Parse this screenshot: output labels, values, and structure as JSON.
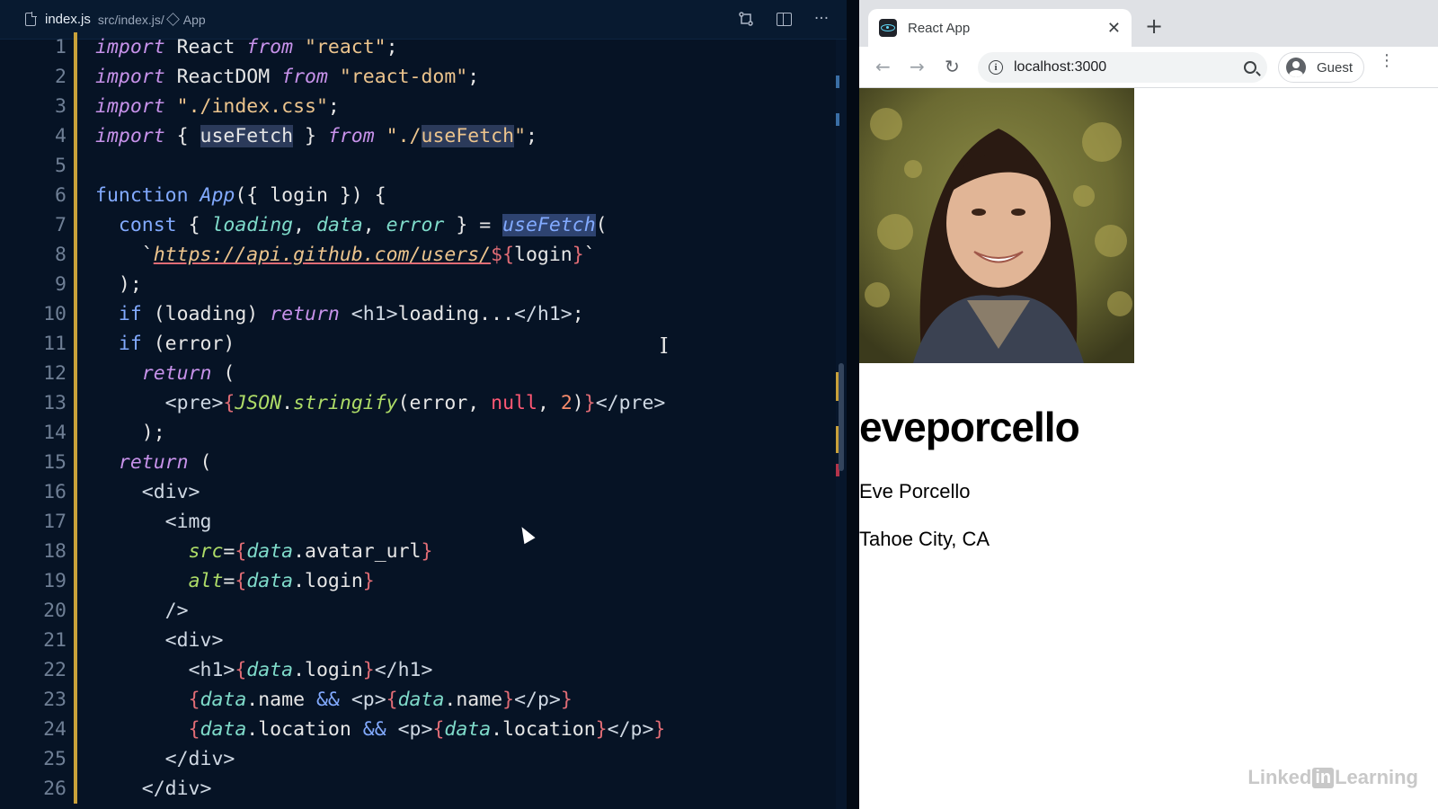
{
  "editor": {
    "filename": "index.js",
    "breadcrumb_path": "src/index.js/",
    "breadcrumb_symbol": "App",
    "line_numbers": [
      "1",
      "2",
      "3",
      "4",
      "5",
      "6",
      "7",
      "8",
      "9",
      "10",
      "11",
      "12",
      "13",
      "14",
      "15",
      "16",
      "17",
      "18",
      "19",
      "20",
      "21",
      "22",
      "23",
      "24",
      "25",
      "26"
    ],
    "lines": [
      [
        [
          "kw",
          "import"
        ],
        [
          "punc",
          " React "
        ],
        [
          "kw",
          "from"
        ],
        [
          "punc",
          " "
        ],
        [
          "str",
          "\"react\""
        ],
        [
          "punc",
          ";"
        ]
      ],
      [
        [
          "kw",
          "import"
        ],
        [
          "punc",
          " ReactDOM "
        ],
        [
          "kw",
          "from"
        ],
        [
          "punc",
          " "
        ],
        [
          "str",
          "\"react-dom\""
        ],
        [
          "punc",
          ";"
        ]
      ],
      [
        [
          "kw",
          "import"
        ],
        [
          "punc",
          " "
        ],
        [
          "str",
          "\"./index.css\""
        ],
        [
          "punc",
          ";"
        ]
      ],
      [
        [
          "kw",
          "import"
        ],
        [
          "punc",
          " { "
        ],
        [
          "hl",
          "useFetch"
        ],
        [
          "punc",
          " } "
        ],
        [
          "kw",
          "from"
        ],
        [
          "punc",
          " "
        ],
        [
          "str",
          "\"./"
        ],
        [
          "hlstr",
          "useFetch"
        ],
        [
          "str",
          "\""
        ],
        [
          "punc",
          ";"
        ]
      ],
      [],
      [
        [
          "kp",
          "function"
        ],
        [
          "punc",
          " "
        ],
        [
          "fn",
          "App"
        ],
        [
          "punc",
          "({ login }) {"
        ]
      ],
      [
        [
          "punc",
          "  "
        ],
        [
          "kp",
          "const"
        ],
        [
          "punc",
          " { "
        ],
        [
          "var",
          "loading"
        ],
        [
          "punc",
          ", "
        ],
        [
          "var",
          "data"
        ],
        [
          "punc",
          ", "
        ],
        [
          "var",
          "error"
        ],
        [
          "punc",
          " } = "
        ],
        [
          "hlfn",
          "useFetch"
        ],
        [
          "punc",
          "("
        ]
      ],
      [
        [
          "punc",
          "    `"
        ],
        [
          "url",
          "https://api.github.com/users/"
        ],
        [
          "br",
          "${"
        ],
        [
          "punc",
          "login"
        ],
        [
          "br",
          "}"
        ],
        [
          "punc",
          "`"
        ]
      ],
      [
        [
          "punc",
          "  );"
        ]
      ],
      [
        [
          "punc",
          "  "
        ],
        [
          "kp",
          "if"
        ],
        [
          "punc",
          " (loading) "
        ],
        [
          "kw",
          "return"
        ],
        [
          "punc",
          " "
        ],
        [
          "tag",
          "<h1>"
        ],
        [
          "punc",
          "loading..."
        ],
        [
          "tag",
          "</h1>"
        ],
        [
          "punc",
          ";"
        ]
      ],
      [
        [
          "punc",
          "  "
        ],
        [
          "kp",
          "if"
        ],
        [
          "punc",
          " (error)"
        ]
      ],
      [
        [
          "punc",
          "    "
        ],
        [
          "kw",
          "return"
        ],
        [
          "punc",
          " ("
        ]
      ],
      [
        [
          "punc",
          "      "
        ],
        [
          "tag",
          "<pre>"
        ],
        [
          "br",
          "{"
        ],
        [
          "attr",
          "JSON"
        ],
        [
          "punc",
          "."
        ],
        [
          "attr",
          "stringify"
        ],
        [
          "punc",
          "(error, "
        ],
        [
          "lit",
          "null"
        ],
        [
          "punc",
          ", "
        ],
        [
          "num",
          "2"
        ],
        [
          "punc",
          ")"
        ],
        [
          "br",
          "}"
        ],
        [
          "tag",
          "</pre>"
        ]
      ],
      [
        [
          "punc",
          "    );"
        ]
      ],
      [
        [
          "punc",
          "  "
        ],
        [
          "kw",
          "return"
        ],
        [
          "punc",
          " ("
        ]
      ],
      [
        [
          "punc",
          "    "
        ],
        [
          "tag",
          "<div>"
        ]
      ],
      [
        [
          "punc",
          "      "
        ],
        [
          "tag",
          "<img"
        ]
      ],
      [
        [
          "punc",
          "        "
        ],
        [
          "attr",
          "src"
        ],
        [
          "punc",
          "="
        ],
        [
          "br",
          "{"
        ],
        [
          "var",
          "data"
        ],
        [
          "punc",
          ".avatar_url"
        ],
        [
          "br",
          "}"
        ]
      ],
      [
        [
          "punc",
          "        "
        ],
        [
          "attr",
          "alt"
        ],
        [
          "punc",
          "="
        ],
        [
          "br",
          "{"
        ],
        [
          "var",
          "data"
        ],
        [
          "punc",
          ".login"
        ],
        [
          "br",
          "}"
        ]
      ],
      [
        [
          "punc",
          "      "
        ],
        [
          "tag",
          "/>"
        ]
      ],
      [
        [
          "punc",
          "      "
        ],
        [
          "tag",
          "<div>"
        ]
      ],
      [
        [
          "punc",
          "        "
        ],
        [
          "tag",
          "<h1>"
        ],
        [
          "br",
          "{"
        ],
        [
          "var",
          "data"
        ],
        [
          "punc",
          ".login"
        ],
        [
          "br",
          "}"
        ],
        [
          "tag",
          "</h1>"
        ]
      ],
      [
        [
          "punc",
          "        "
        ],
        [
          "br",
          "{"
        ],
        [
          "var",
          "data"
        ],
        [
          "punc",
          ".name "
        ],
        [
          "kp",
          "&&"
        ],
        [
          "punc",
          " "
        ],
        [
          "tag",
          "<p>"
        ],
        [
          "br",
          "{"
        ],
        [
          "var",
          "data"
        ],
        [
          "punc",
          ".name"
        ],
        [
          "br",
          "}"
        ],
        [
          "tag",
          "</p>"
        ],
        [
          "br",
          "}"
        ]
      ],
      [
        [
          "punc",
          "        "
        ],
        [
          "br",
          "{"
        ],
        [
          "var",
          "data"
        ],
        [
          "punc",
          ".location "
        ],
        [
          "kp",
          "&&"
        ],
        [
          "punc",
          " "
        ],
        [
          "tag",
          "<p>"
        ],
        [
          "br",
          "{"
        ],
        [
          "var",
          "data"
        ],
        [
          "punc",
          ".location"
        ],
        [
          "br",
          "}"
        ],
        [
          "tag",
          "</p>"
        ],
        [
          "br",
          "}"
        ]
      ],
      [
        [
          "punc",
          "      "
        ],
        [
          "tag",
          "</div>"
        ]
      ],
      [
        [
          "punc",
          "    "
        ],
        [
          "tag",
          "</div>"
        ]
      ]
    ],
    "modified_lines": [
      1,
      2,
      3,
      4,
      5,
      6,
      7,
      8,
      9,
      10,
      11,
      12,
      13,
      14,
      15,
      16,
      17,
      18,
      19,
      20,
      21,
      22,
      23,
      24,
      25,
      26
    ]
  },
  "browser": {
    "tab_title": "React App",
    "url": "localhost:3000",
    "profile_label": "Guest"
  },
  "profile_page": {
    "login": "eveporcello",
    "name": "Eve Porcello",
    "location": "Tahoe City, CA",
    "avatar_alt": "eveporcello"
  },
  "watermark": {
    "left": "Linked",
    "mid": "in",
    "right": "Learning"
  },
  "colors": {
    "editor_bg": "#061325",
    "keyword": "#c792ea",
    "string": "#ecc48d",
    "function": "#82aaff",
    "variable": "#7fdbca",
    "bracket": "#e06c75",
    "modified_gutter": "#c9a13a"
  }
}
